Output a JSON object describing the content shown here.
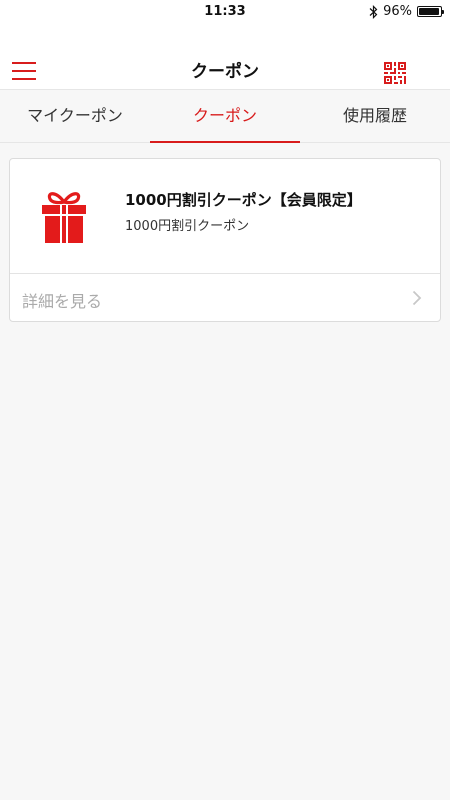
{
  "status_bar": {
    "time": "11:33",
    "battery": "96%",
    "battery_level": 0.96
  },
  "header": {
    "title": "クーポン"
  },
  "tabs": [
    {
      "label": "マイクーポン",
      "active": false
    },
    {
      "label": "クーポン",
      "active": true
    },
    {
      "label": "使用履歴",
      "active": false
    }
  ],
  "coupon": {
    "title": "1000円割引クーポン【会員限定】",
    "subtitle": "1000円割引クーポン",
    "detail_link": "詳細を見る"
  },
  "colors": {
    "accent": "#d81c1c",
    "background": "#f7f7f7"
  },
  "icons": [
    "menu-icon",
    "qr-code-icon",
    "gift-icon",
    "chevron-right-icon",
    "bluetooth-icon",
    "battery-icon"
  ]
}
